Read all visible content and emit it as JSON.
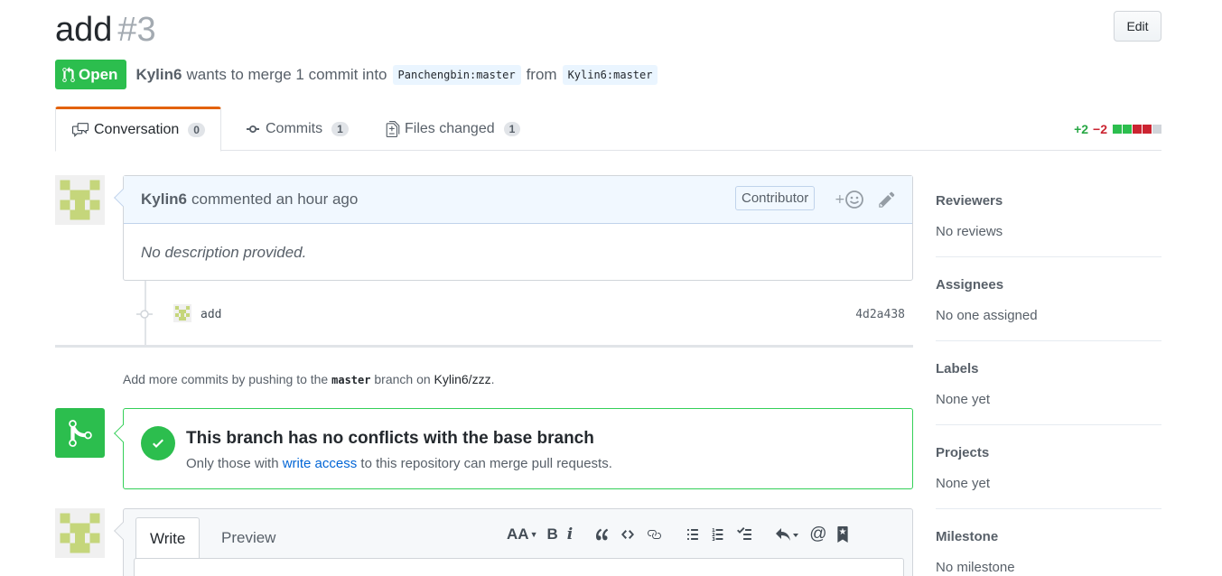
{
  "pr": {
    "title": "add",
    "number": "#3",
    "edit_label": "Edit",
    "state": "Open",
    "author": "Kylin6",
    "wants_text": "wants to merge 1 commit into",
    "base_branch": "Panchengbin:master",
    "from_text": "from",
    "head_branch": "Kylin6:master"
  },
  "tabs": [
    {
      "label": "Conversation",
      "count": "0",
      "icon": "comment-discussion-icon"
    },
    {
      "label": "Commits",
      "count": "1",
      "icon": "git-commit-icon"
    },
    {
      "label": "Files changed",
      "count": "1",
      "icon": "file-diff-icon"
    }
  ],
  "diffstat": {
    "additions": "+2",
    "deletions": "−2"
  },
  "comment": {
    "author": "Kylin6",
    "action": "commented",
    "time": "an hour ago",
    "role": "Contributor",
    "body": "No description provided."
  },
  "commit": {
    "message": "add",
    "sha": "4d2a438"
  },
  "hint": {
    "prefix": "Add more commits by pushing to the",
    "branch": "master",
    "middle": "branch on",
    "repo": "Kylin6/zzz",
    "suffix": "."
  },
  "merge": {
    "heading": "This branch has no conflicts with the base branch",
    "sub_prefix": "Only those with",
    "link": "write access",
    "sub_suffix": "to this repository can merge pull requests."
  },
  "editor": {
    "write_tab": "Write",
    "preview_tab": "Preview",
    "header_tool": "AA",
    "bold_tool": "B",
    "italic_tool": "i",
    "mention_tool": "@"
  },
  "sidebar": [
    {
      "heading": "Reviewers",
      "value": "No reviews"
    },
    {
      "heading": "Assignees",
      "value": "No one assigned"
    },
    {
      "heading": "Labels",
      "value": "None yet"
    },
    {
      "heading": "Projects",
      "value": "None yet"
    },
    {
      "heading": "Milestone",
      "value": "No milestone"
    }
  ],
  "colors": {
    "open_green": "#2cbe4e",
    "link_blue": "#0366d6",
    "tab_accent": "#e36209",
    "added": "#28a745",
    "deleted": "#cb2431"
  }
}
